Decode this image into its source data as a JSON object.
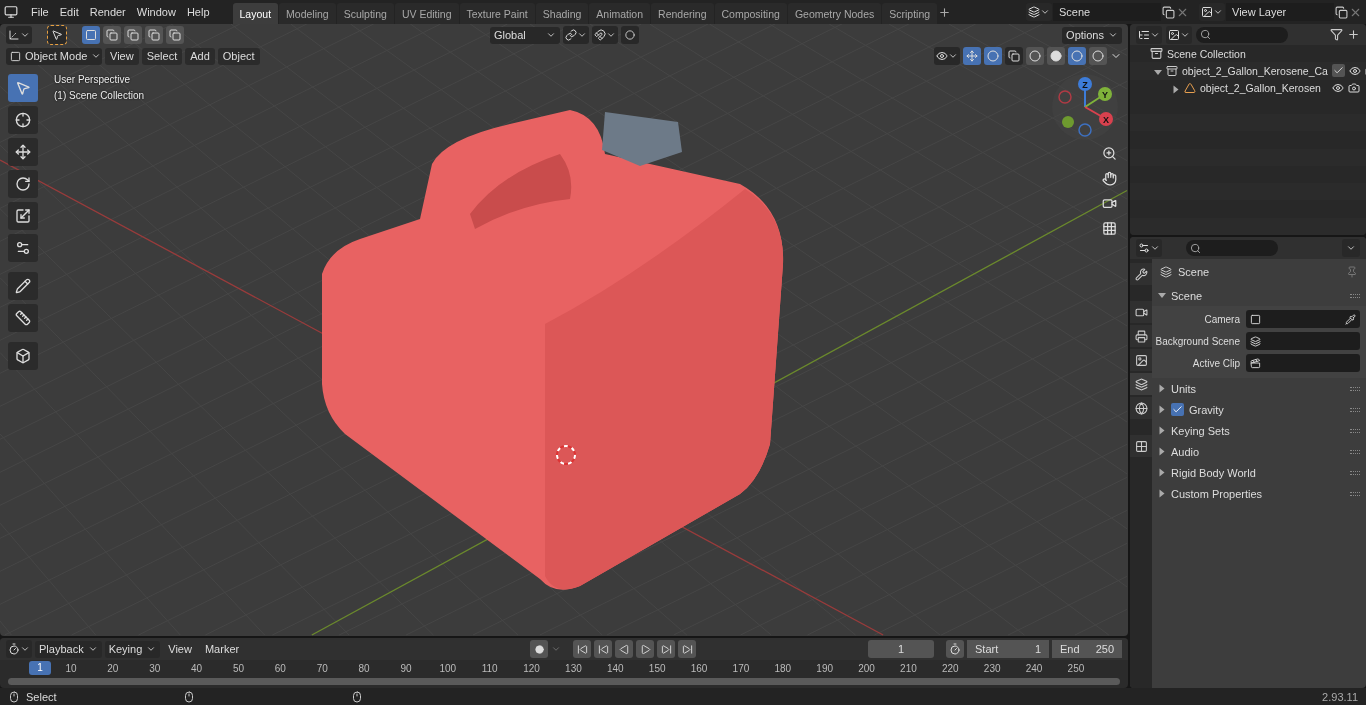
{
  "menu_bar": {
    "items": [
      "File",
      "Edit",
      "Render",
      "Window",
      "Help"
    ]
  },
  "workspace_tabs": [
    {
      "label": "Layout",
      "selected": true
    },
    {
      "label": "Modeling",
      "selected": false
    },
    {
      "label": "Sculpting",
      "selected": false
    },
    {
      "label": "UV Editing",
      "selected": false
    },
    {
      "label": "Texture Paint",
      "selected": false
    },
    {
      "label": "Shading",
      "selected": false
    },
    {
      "label": "Animation",
      "selected": false
    },
    {
      "label": "Rendering",
      "selected": false
    },
    {
      "label": "Compositing",
      "selected": false
    },
    {
      "label": "Geometry Nodes",
      "selected": false
    },
    {
      "label": "Scripting",
      "selected": false
    }
  ],
  "scene_field": {
    "value": "Scene"
  },
  "view_layer_field": {
    "value": "View Layer"
  },
  "viewport": {
    "select_modes": [
      {
        "selected": true
      },
      {
        "selected": false
      },
      {
        "selected": false
      },
      {
        "selected": false
      },
      {
        "selected": false
      }
    ],
    "orientation": "Global",
    "options": "Options",
    "mode": "Object Mode",
    "menus": [
      "View",
      "Select",
      "Add",
      "Object"
    ],
    "shading_modes": [
      {
        "selected": false
      },
      {
        "selected": false
      },
      {
        "selected": true
      },
      {
        "selected": false
      }
    ],
    "overlay_text": [
      "User Perspective",
      "(1) Scene Collection"
    ],
    "tools": [
      {
        "selected": true
      },
      {
        "selected": false
      },
      {
        "selected": false
      },
      {
        "selected": false
      },
      {
        "selected": false
      },
      {
        "selected": false
      },
      {
        "selected": false
      },
      {
        "selected": false
      },
      {
        "selected": false
      }
    ],
    "gizmo_axes": [
      "Z",
      "Y",
      "X"
    ]
  },
  "outliner": {
    "root": "Scene Collection",
    "items": [
      {
        "label": "object_2_Gallon_Kerosene_Ca",
        "kind": "collection",
        "expanded": true,
        "checked": true,
        "children": [
          {
            "label": "object_2_Gallon_Kerosen",
            "kind": "object",
            "expanded": false
          }
        ]
      }
    ]
  },
  "properties": {
    "tabs": [
      {
        "selected": false
      },
      {
        "selected": false
      },
      {
        "selected": false
      },
      {
        "selected": false
      },
      {
        "selected": true
      },
      {
        "selected": false
      },
      {
        "selected": false
      }
    ],
    "context": "Scene",
    "panel": {
      "title": "Scene",
      "expanded": true,
      "fields": [
        {
          "label": "Camera"
        },
        {
          "label": "Background Scene"
        },
        {
          "label": "Active Clip"
        }
      ]
    },
    "subpanels": [
      {
        "title": "Units",
        "kind": "plain"
      },
      {
        "title": "Gravity",
        "kind": "checkbox",
        "checked": true
      },
      {
        "title": "Keying Sets",
        "kind": "plain"
      },
      {
        "title": "Audio",
        "kind": "plain"
      },
      {
        "title": "Rigid Body World",
        "kind": "plain"
      },
      {
        "title": "Custom Properties",
        "kind": "plain"
      }
    ]
  },
  "timeline": {
    "menus": [
      "Playback",
      "Keying",
      "View",
      "Marker"
    ],
    "current_frame": "1",
    "start_label": "Start",
    "start": "1",
    "end_label": "End",
    "end": "250",
    "playhead": "1",
    "ruler": [
      "10",
      "20",
      "30",
      "40",
      "50",
      "60",
      "70",
      "80",
      "90",
      "100",
      "110",
      "120",
      "130",
      "140",
      "150",
      "160",
      "170",
      "180",
      "190",
      "200",
      "210",
      "220",
      "230",
      "240",
      "250"
    ]
  },
  "status_bar": {
    "hint": "Select",
    "version": "2.93.11"
  }
}
